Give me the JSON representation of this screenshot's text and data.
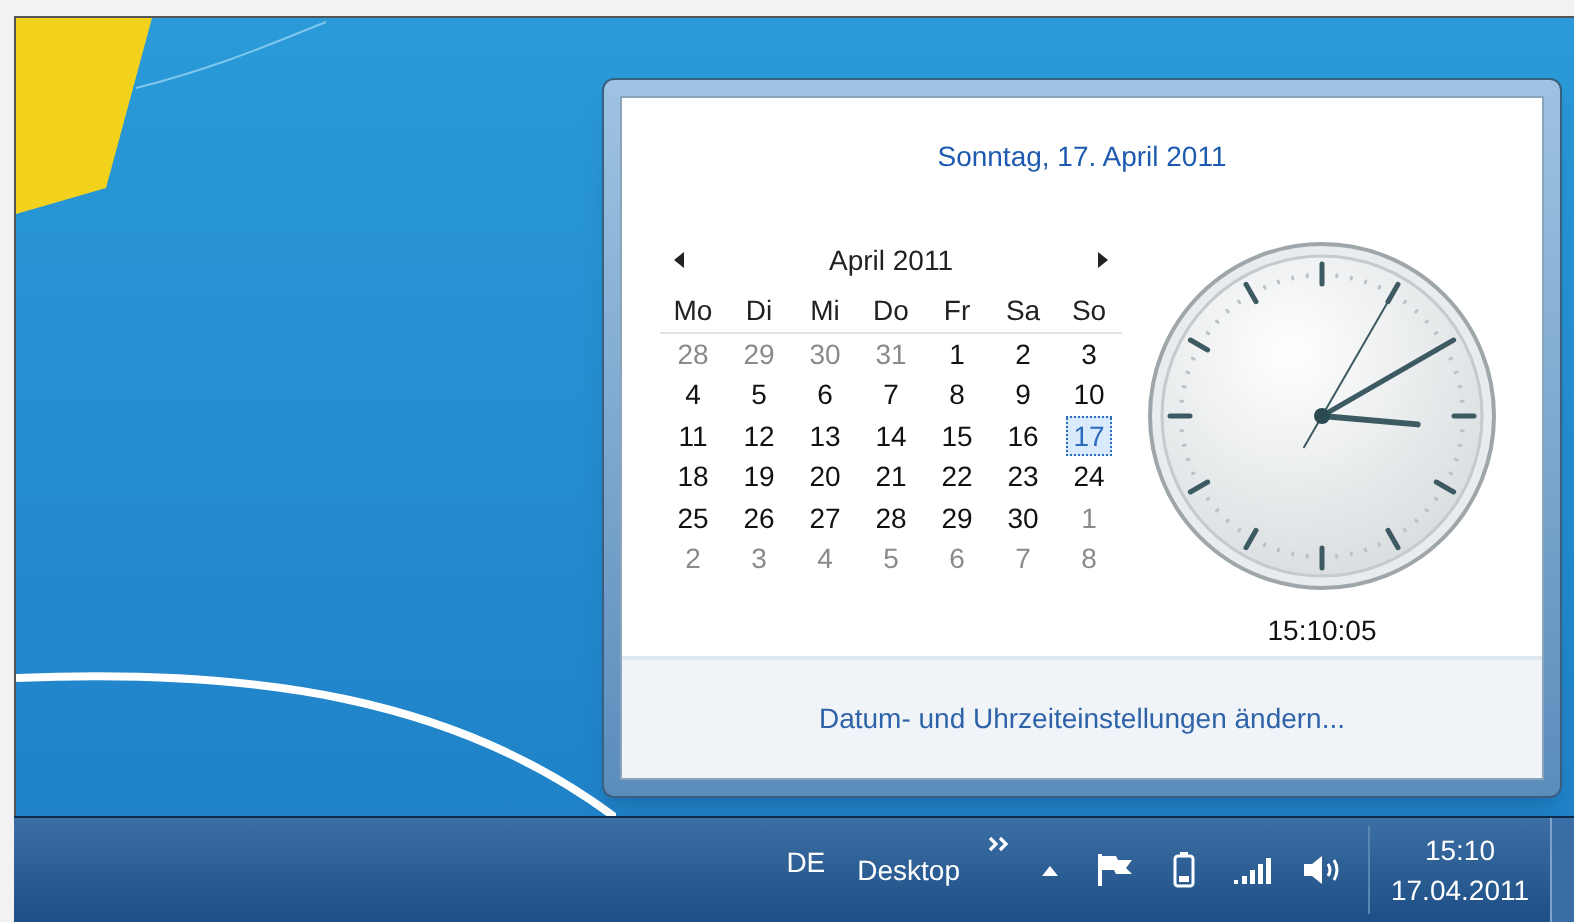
{
  "popup": {
    "date_heading": "Sonntag, 17. April 2011",
    "calendar": {
      "month_label": "April 2011",
      "weekdays": [
        "Mo",
        "Di",
        "Mi",
        "Do",
        "Fr",
        "Sa",
        "So"
      ],
      "weeks": [
        [
          {
            "day": "28",
            "muted": true,
            "selected": false
          },
          {
            "day": "29",
            "muted": true,
            "selected": false
          },
          {
            "day": "30",
            "muted": true,
            "selected": false
          },
          {
            "day": "31",
            "muted": true,
            "selected": false
          },
          {
            "day": "1",
            "muted": false,
            "selected": false
          },
          {
            "day": "2",
            "muted": false,
            "selected": false
          },
          {
            "day": "3",
            "muted": false,
            "selected": false
          }
        ],
        [
          {
            "day": "4",
            "muted": false,
            "selected": false
          },
          {
            "day": "5",
            "muted": false,
            "selected": false
          },
          {
            "day": "6",
            "muted": false,
            "selected": false
          },
          {
            "day": "7",
            "muted": false,
            "selected": false
          },
          {
            "day": "8",
            "muted": false,
            "selected": false
          },
          {
            "day": "9",
            "muted": false,
            "selected": false
          },
          {
            "day": "10",
            "muted": false,
            "selected": false
          }
        ],
        [
          {
            "day": "11",
            "muted": false,
            "selected": false
          },
          {
            "day": "12",
            "muted": false,
            "selected": false
          },
          {
            "day": "13",
            "muted": false,
            "selected": false
          },
          {
            "day": "14",
            "muted": false,
            "selected": false
          },
          {
            "day": "15",
            "muted": false,
            "selected": false
          },
          {
            "day": "16",
            "muted": false,
            "selected": false
          },
          {
            "day": "17",
            "muted": false,
            "selected": true
          }
        ],
        [
          {
            "day": "18",
            "muted": false,
            "selected": false
          },
          {
            "day": "19",
            "muted": false,
            "selected": false
          },
          {
            "day": "20",
            "muted": false,
            "selected": false
          },
          {
            "day": "21",
            "muted": false,
            "selected": false
          },
          {
            "day": "22",
            "muted": false,
            "selected": false
          },
          {
            "day": "23",
            "muted": false,
            "selected": false
          },
          {
            "day": "24",
            "muted": false,
            "selected": false
          }
        ],
        [
          {
            "day": "25",
            "muted": false,
            "selected": false
          },
          {
            "day": "26",
            "muted": false,
            "selected": false
          },
          {
            "day": "27",
            "muted": false,
            "selected": false
          },
          {
            "day": "28",
            "muted": false,
            "selected": false
          },
          {
            "day": "29",
            "muted": false,
            "selected": false
          },
          {
            "day": "30",
            "muted": false,
            "selected": false
          },
          {
            "day": "1",
            "muted": true,
            "selected": false
          }
        ],
        [
          {
            "day": "2",
            "muted": true,
            "selected": false
          },
          {
            "day": "3",
            "muted": true,
            "selected": false
          },
          {
            "day": "4",
            "muted": true,
            "selected": false
          },
          {
            "day": "5",
            "muted": true,
            "selected": false
          },
          {
            "day": "6",
            "muted": true,
            "selected": false
          },
          {
            "day": "7",
            "muted": true,
            "selected": false
          },
          {
            "day": "8",
            "muted": true,
            "selected": false
          }
        ]
      ]
    },
    "clock": {
      "time": "15:10:05"
    },
    "footer_link": "Datum- und Uhrzeiteinstellungen ändern..."
  },
  "taskbar": {
    "language": "DE",
    "toolbar_label": "Desktop",
    "clock_time": "15:10",
    "clock_date": "17.04.2011"
  }
}
